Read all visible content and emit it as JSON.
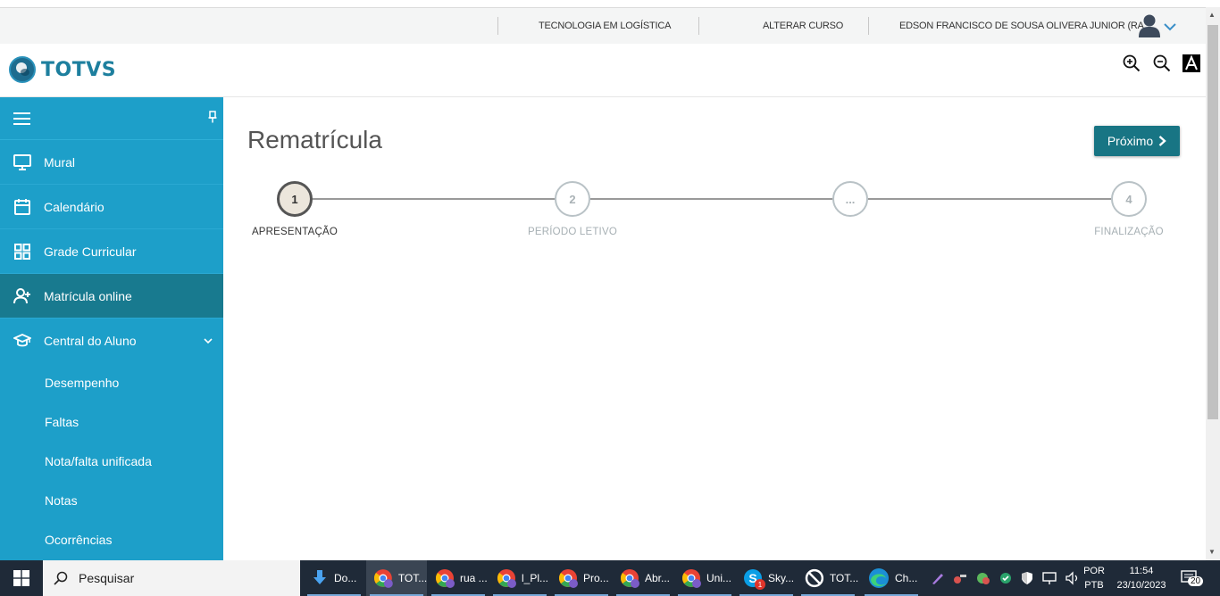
{
  "topbar": {
    "course": "TECNOLOGIA EM LOGÍSTICA",
    "change_course": "ALTERAR CURSO",
    "user": "EDSON FRANCISCO DE SOUSA OLIVERA JUNIOR (RA:..."
  },
  "header": {
    "brand": "TOTVS"
  },
  "sidebar": {
    "items": [
      {
        "label": "Mural"
      },
      {
        "label": "Calendário"
      },
      {
        "label": "Grade Curricular"
      },
      {
        "label": "Matrícula online"
      },
      {
        "label": "Central do Aluno"
      }
    ],
    "subitems": [
      {
        "label": "Desempenho"
      },
      {
        "label": "Faltas"
      },
      {
        "label": "Nota/falta unificada"
      },
      {
        "label": "Notas"
      },
      {
        "label": "Ocorrências"
      }
    ]
  },
  "main": {
    "title": "Rematrícula",
    "next_button": "Próximo",
    "steps": [
      {
        "number": "1",
        "label": "APRESENTAÇÃO"
      },
      {
        "number": "2",
        "label": "PERÍODO LETIVO"
      },
      {
        "number": "...",
        "label": ""
      },
      {
        "number": "4",
        "label": "FINALIZAÇÃO"
      }
    ]
  },
  "taskbar": {
    "search_placeholder": "Pesquisar",
    "apps": [
      {
        "label": "Do...",
        "icon": "download-icon"
      },
      {
        "label": "TOT...",
        "icon": "chrome-icon"
      },
      {
        "label": "rua ...",
        "icon": "chrome-icon"
      },
      {
        "label": "l_Pl...",
        "icon": "chrome-icon"
      },
      {
        "label": "Pro...",
        "icon": "chrome-icon"
      },
      {
        "label": "Abr...",
        "icon": "chrome-icon"
      },
      {
        "label": "Uni...",
        "icon": "chrome-icon"
      },
      {
        "label": "Sky...",
        "icon": "skype-icon"
      },
      {
        "label": "TOT...",
        "icon": "totvs-icon"
      },
      {
        "label": "Ch...",
        "icon": "edge-icon"
      }
    ],
    "language_top": "POR",
    "language_bottom": "PTB",
    "time": "11:54",
    "date": "23/10/2023",
    "notifications": "20",
    "skype_badge": "1"
  },
  "colors": {
    "sidebar": "#1d9fc9",
    "sidebar_active": "#187a8f",
    "primary_button": "#187584",
    "brand": "#1d7f9e"
  }
}
